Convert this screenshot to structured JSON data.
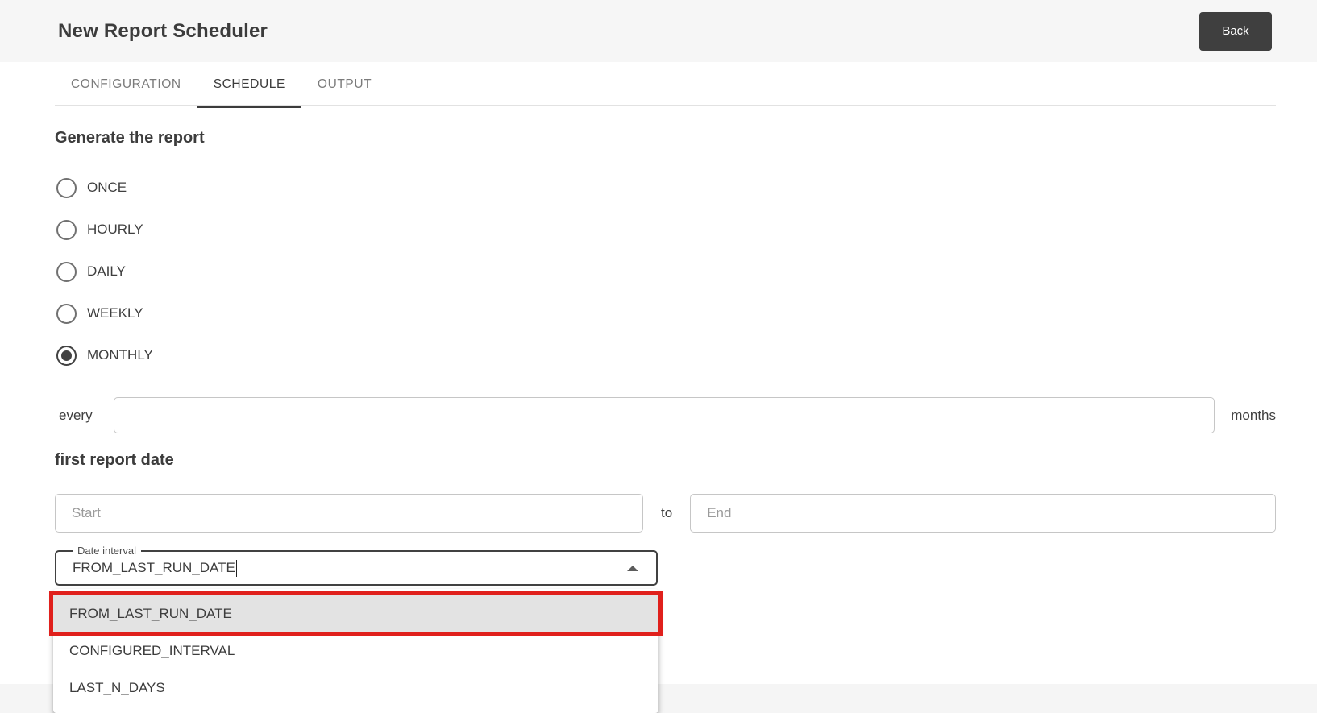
{
  "header": {
    "title": "New Report Scheduler",
    "back_label": "Back"
  },
  "tabs": [
    {
      "label": "CONFIGURATION",
      "active": false
    },
    {
      "label": "SCHEDULE",
      "active": true
    },
    {
      "label": "OUTPUT",
      "active": false
    }
  ],
  "schedule": {
    "section_title": "Generate the report",
    "frequency_options": [
      {
        "label": "ONCE",
        "selected": false
      },
      {
        "label": "HOURLY",
        "selected": false
      },
      {
        "label": "DAILY",
        "selected": false
      },
      {
        "label": "WEEKLY",
        "selected": false
      },
      {
        "label": "MONTHLY",
        "selected": true
      }
    ],
    "interval": {
      "prefix_label": "every",
      "value": "",
      "suffix_label": "months"
    },
    "first_report_date": {
      "section_title": "first report date",
      "start_placeholder": "Start",
      "to_label": "to",
      "end_placeholder": "End"
    },
    "date_interval": {
      "label": "Date interval",
      "value": "FROM_LAST_RUN_DATE",
      "options": [
        {
          "label": "FROM_LAST_RUN_DATE",
          "highlighted": true
        },
        {
          "label": "CONFIGURED_INTERVAL",
          "highlighted": false
        },
        {
          "label": "LAST_N_DAYS",
          "highlighted": false
        }
      ]
    }
  },
  "colors": {
    "header_bg": "#f6f6f6",
    "footer_bg": "#f5f5f5",
    "dark_text": "#3c3c3c",
    "back_button_bg": "#3f3f3f",
    "tab_inactive": "#7b7b7b",
    "tab_indicator": "#3c3c3c",
    "input_border": "#c6c6c6",
    "select_border": "#414141",
    "highlight_red": "#e0201c",
    "option_highlight_bg": "#e3e3e3"
  }
}
